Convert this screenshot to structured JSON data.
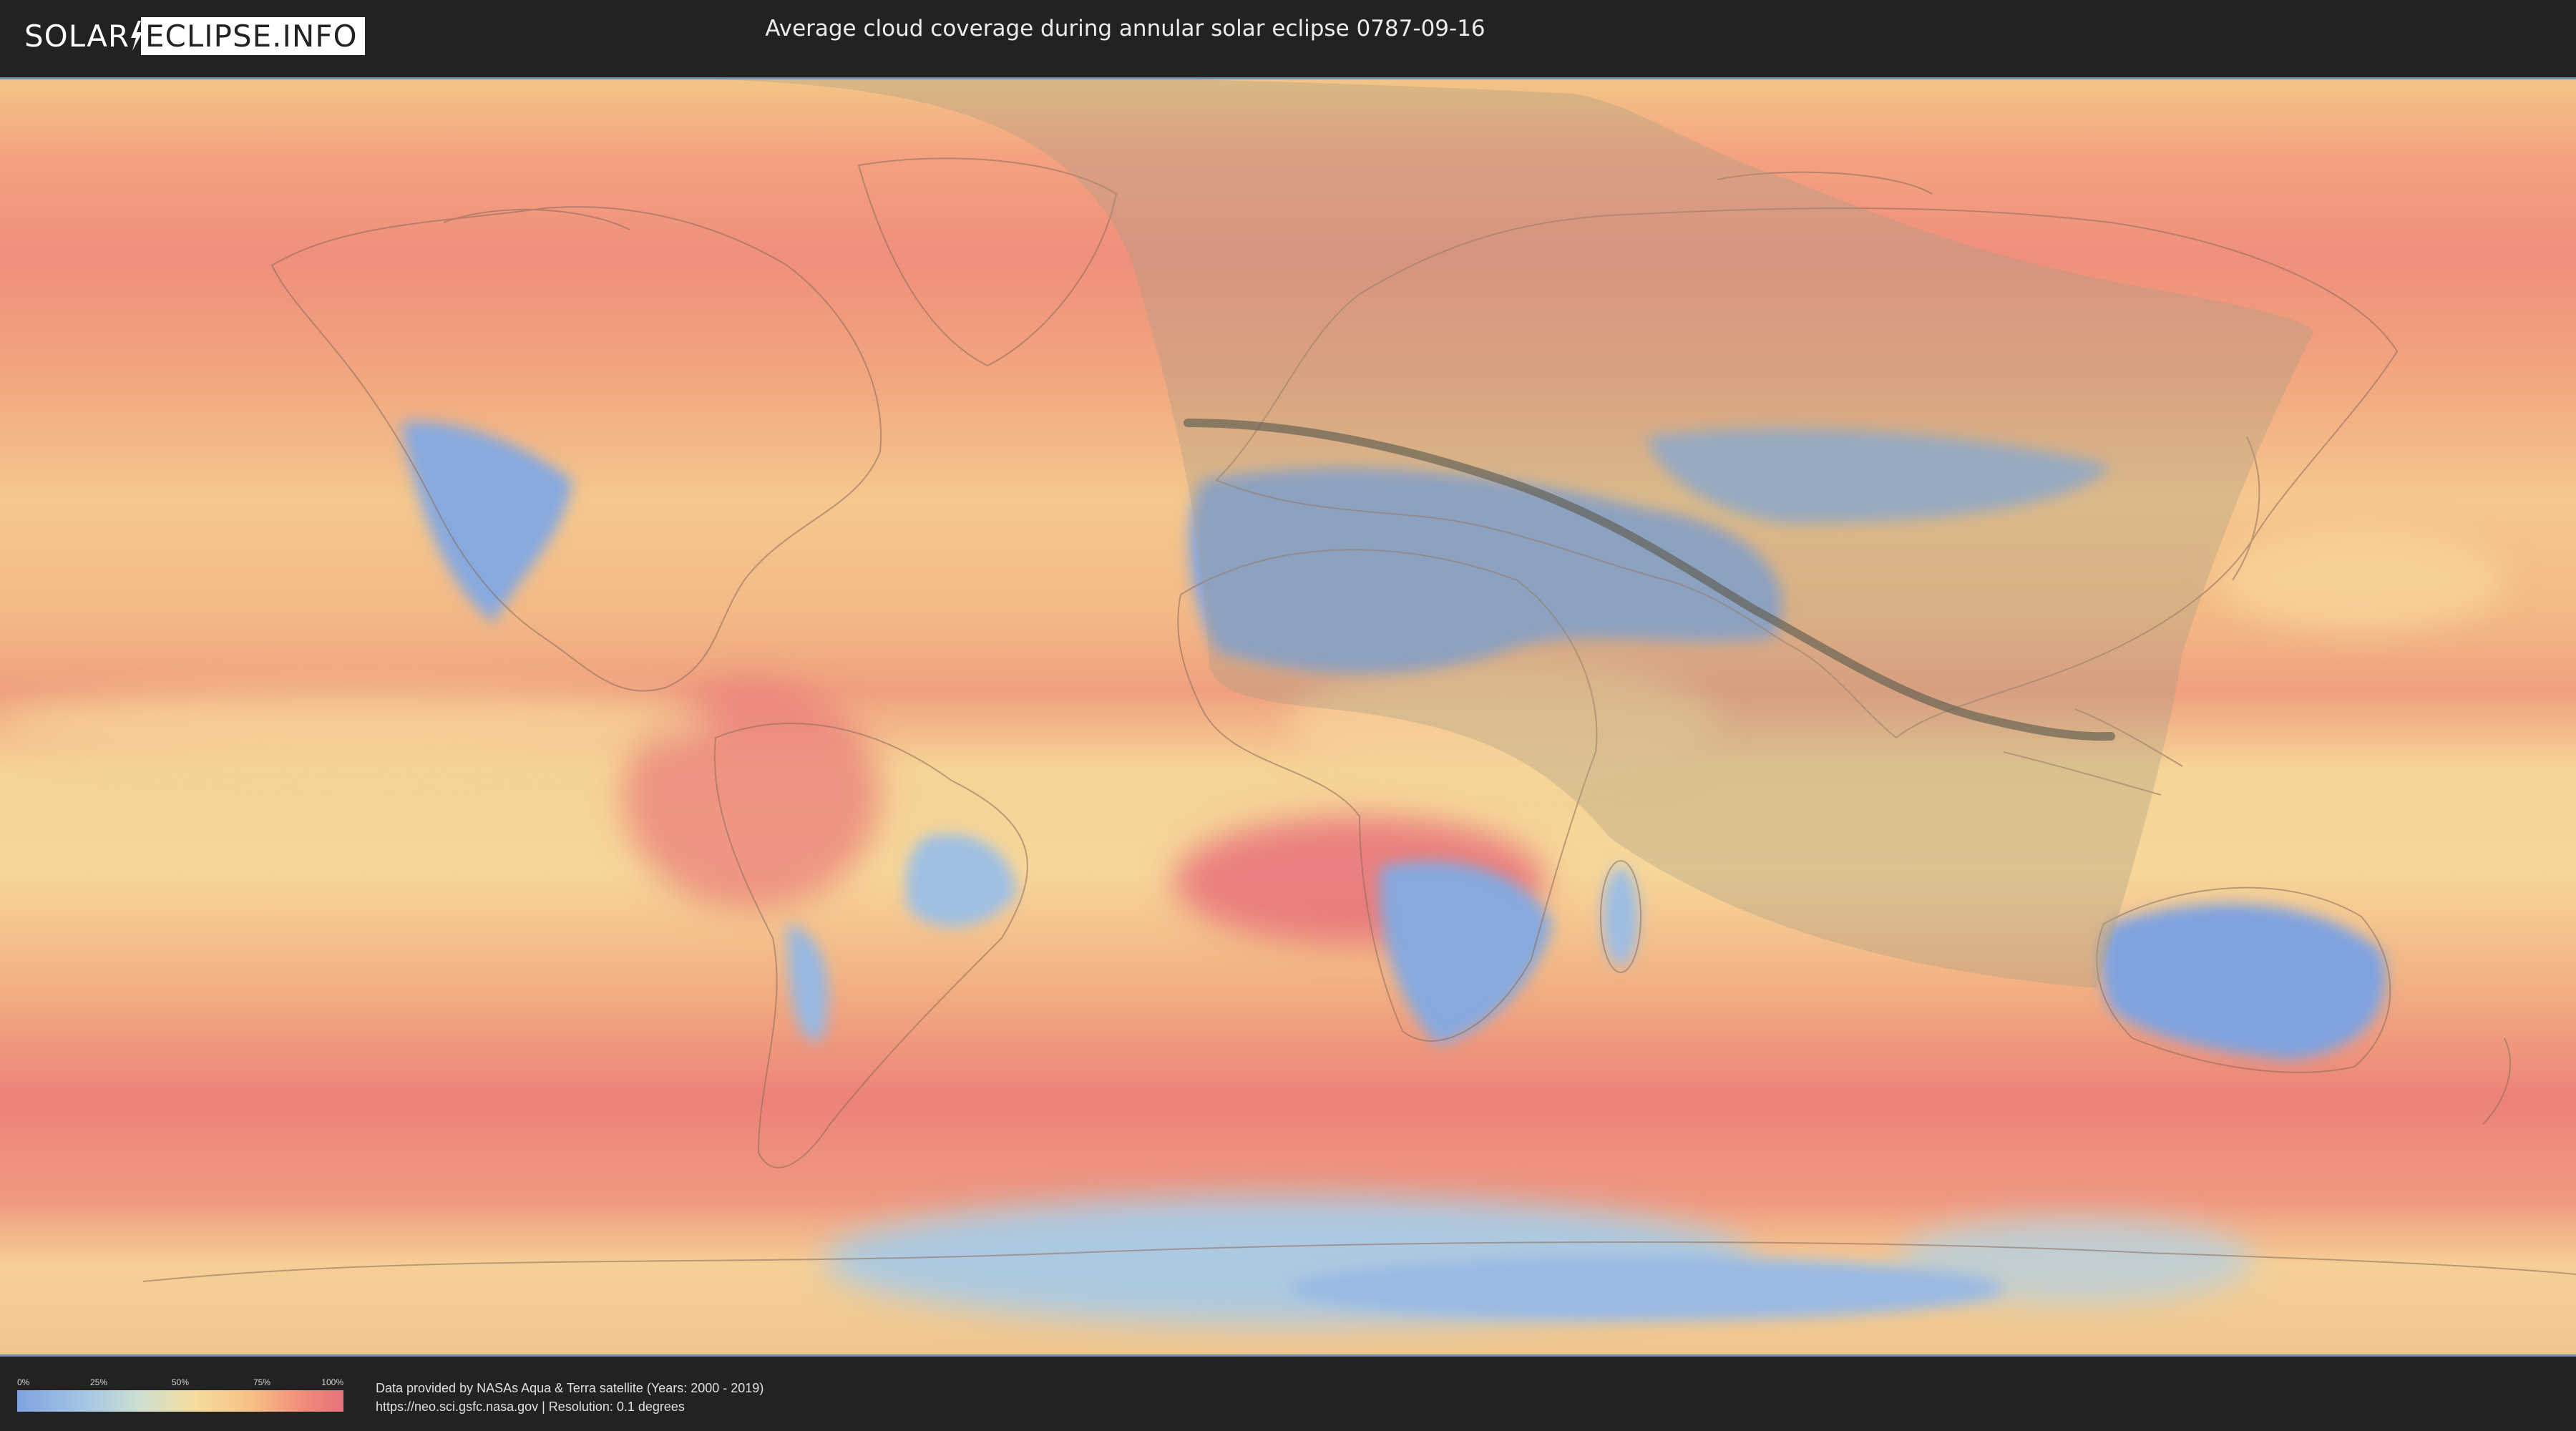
{
  "header": {
    "logo_left": "SOLAR",
    "logo_right": "ECLIPSE.INFO",
    "title": "Average cloud coverage during annular solar eclipse 0787-09-16"
  },
  "legend": {
    "ticks": [
      "0%",
      "25%",
      "50%",
      "75%",
      "100%"
    ],
    "tick_values": [
      0,
      25,
      50,
      75,
      100
    ],
    "colors": [
      "#7fa3e0",
      "#a7c8e4",
      "#f6dc9e",
      "#f7c085",
      "#e7727c"
    ]
  },
  "credits": {
    "line1": "Data provided by NASAs Aqua & Terra satellite (Years: 2000 - 2019)",
    "line2": "https://neo.sci.gsfc.nasa.gov | Resolution: 0.1 degrees"
  },
  "map": {
    "projection": "equirectangular",
    "central_path_color": "#6b6b5e",
    "penumbra_color": "#a89f84"
  }
}
